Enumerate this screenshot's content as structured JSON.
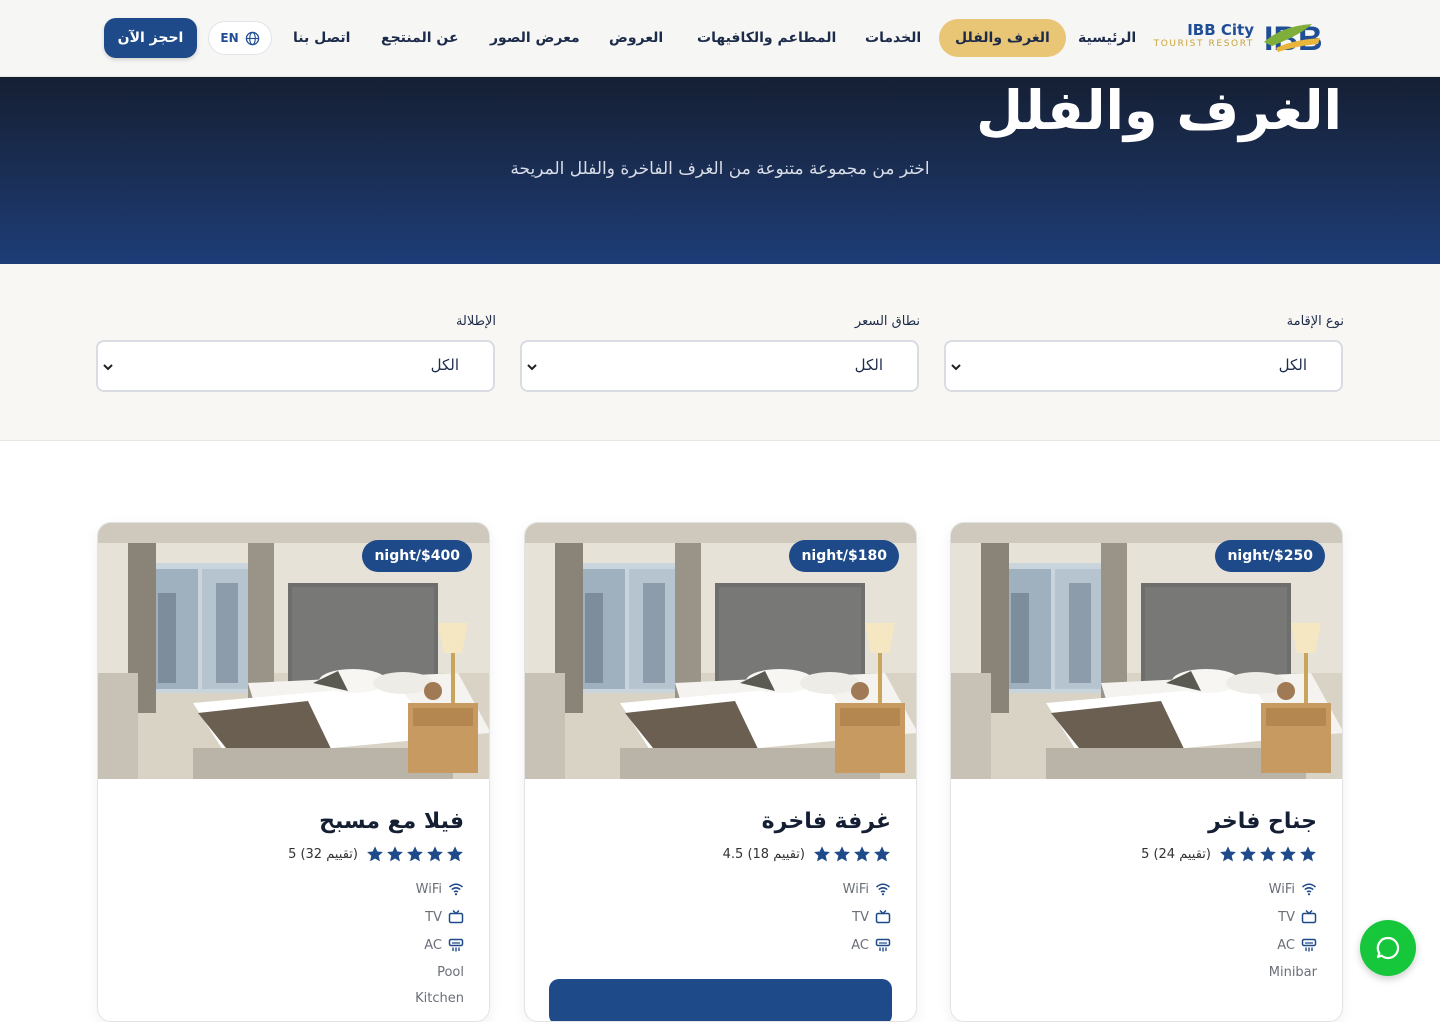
{
  "brand": {
    "name": "IBB City",
    "tagline": "TOURIST RESORT",
    "mark": "IBB"
  },
  "nav": {
    "home": "الرئيسية",
    "rooms": "الغرف والفلل",
    "services": "الخدمات",
    "restaurants": "المطاعم والكافيهات",
    "offers": "العروض",
    "gallery": "معرض الصور",
    "about": "عن المنتجع",
    "contact": "اتصل بنا",
    "lang": "EN",
    "book": "احجز الآن"
  },
  "hero": {
    "title": "الغرف والفلل",
    "subtitle": "اختر من مجموعة متنوعة من الغرف الفاخرة والفلل المريحة"
  },
  "filters": {
    "type_label": "نوع الإقامة",
    "type_value": "الكل",
    "price_label": "نطاق السعر",
    "price_value": "الكل",
    "view_label": "الإطلالة",
    "view_value": "الكل"
  },
  "cards": [
    {
      "price": "night/$250",
      "title": "جناح فاخر",
      "rating": "5 (24 تقييم)",
      "stars": 5,
      "amenities": [
        "WiFi",
        "TV",
        "AC",
        "Minibar"
      ]
    },
    {
      "price": "night/$180",
      "title": "غرفة فاخرة",
      "rating": "4.5 (18 تقييم)",
      "stars": 4.5,
      "amenities": [
        "WiFi",
        "TV",
        "AC"
      ]
    },
    {
      "price": "night/$400",
      "title": "فيلا مع مسبح",
      "rating": "5 (32 تقييم)",
      "stars": 5,
      "amenities": [
        "WiFi",
        "TV",
        "AC",
        "Pool",
        "Kitchen"
      ]
    }
  ],
  "colors": {
    "primary": "#1f4a8a",
    "accent": "#e9c576",
    "hero_dark": "#151f33",
    "whatsapp": "#16c73c"
  },
  "icons": {
    "wifi": "wifi-icon",
    "tv": "tv-icon",
    "ac": "ac-icon",
    "globe": "globe-icon",
    "star": "star-icon",
    "chat": "chat-bubble-icon"
  }
}
